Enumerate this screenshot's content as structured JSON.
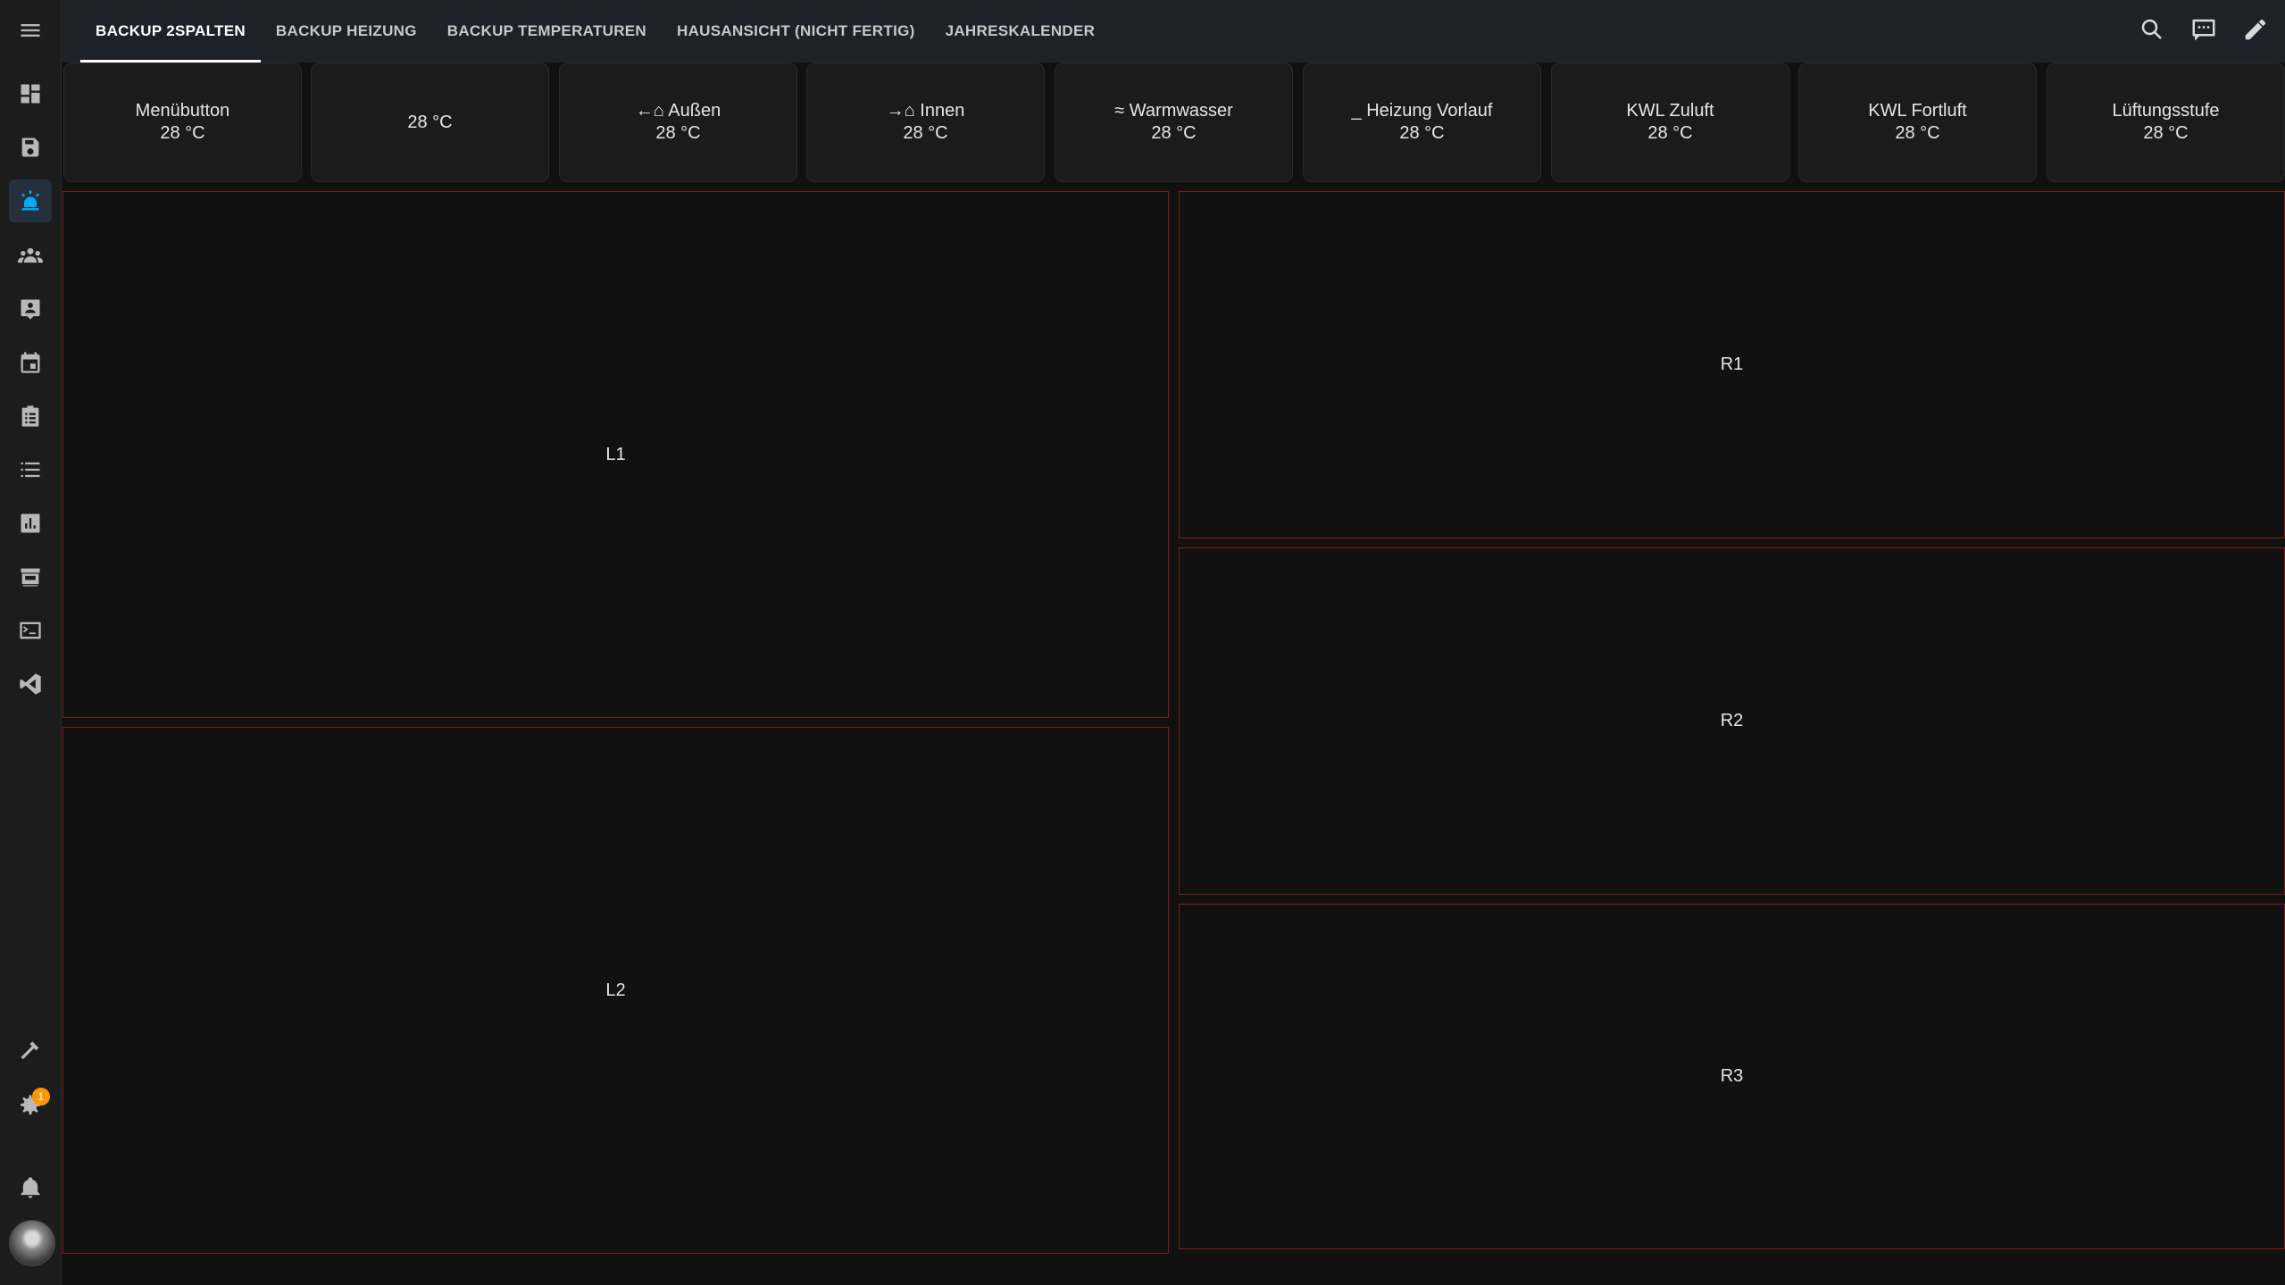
{
  "tabs": [
    {
      "label": "BACKUP 2SPALTEN"
    },
    {
      "label": "BACKUP HEIZUNG"
    },
    {
      "label": "BACKUP TEMPERATUREN"
    },
    {
      "label": "HAUSANSICHT (NICHT FERTIG)"
    },
    {
      "label": "JAHRESKALENDER"
    }
  ],
  "tiles": [
    {
      "name": "Menübutton",
      "value": "28 °C"
    },
    {
      "name": "",
      "value": "28 °C"
    },
    {
      "name": "←⌂ Außen",
      "value": "28 °C"
    },
    {
      "name": "→⌂ Innen",
      "value": "28 °C"
    },
    {
      "name": "≈ Warmwasser",
      "value": "28 °C"
    },
    {
      "name": "_ Heizung Vorlauf",
      "value": "28 °C"
    },
    {
      "name": "KWL Zuluft",
      "value": "28 °C"
    },
    {
      "name": "KWL Fortluft",
      "value": "28 °C"
    },
    {
      "name": "Lüftungsstufe",
      "value": "28 °C"
    }
  ],
  "panels": {
    "l1": "L1",
    "l2": "L2",
    "r1": "R1",
    "r2": "R2",
    "r3": "R3"
  },
  "sidebar": {
    "icons": [
      "menu-icon",
      "dashboard-icon",
      "save-icon",
      "alarm-light-icon",
      "people-icon",
      "contact-card-icon",
      "calendar-icon",
      "clipboard-icon",
      "list-icon",
      "chart-icon",
      "hacs-store-icon",
      "terminal-icon",
      "vscode-icon",
      "hammer-icon",
      "settings-icon",
      "bell-icon"
    ],
    "settings_badge": "1",
    "accent_color": "#03a9f4"
  },
  "header_actions": [
    "search-icon",
    "assist-chat-icon",
    "edit-pencil-icon"
  ]
}
